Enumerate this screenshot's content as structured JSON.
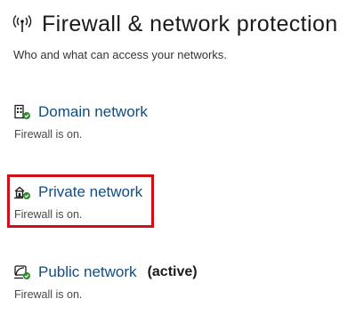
{
  "header": {
    "title": "Firewall & network protection",
    "icon": "wireless-antenna-icon"
  },
  "subtitle": "Who and what can access your networks.",
  "networks": [
    {
      "name": "Domain network",
      "icon": "domain-network-icon",
      "status": "Firewall is on.",
      "active_label": ""
    },
    {
      "name": "Private network",
      "icon": "private-network-icon",
      "status": "Firewall is on.",
      "active_label": "",
      "highlighted": true
    },
    {
      "name": "Public network",
      "icon": "public-network-icon",
      "status": "Firewall is on.",
      "active_label": "(active)"
    }
  ],
  "colors": {
    "link": "#104d85",
    "highlight": "#d01018",
    "ok_badge": "#2e8b2e"
  }
}
